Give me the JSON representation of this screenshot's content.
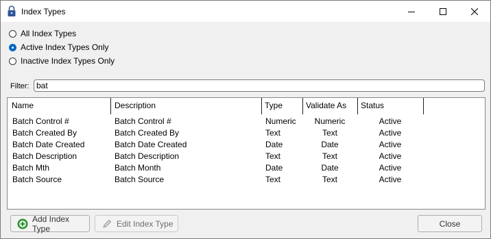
{
  "window": {
    "title": "Index Types",
    "icons": {
      "app": "padlock-icon",
      "minimize": "minimize-icon",
      "maximize": "maximize-icon",
      "close": "close-icon"
    }
  },
  "filter_options": [
    {
      "label": "All Index Types",
      "checked": false
    },
    {
      "label": "Active Index Types Only",
      "checked": true
    },
    {
      "label": "Inactive Index Types Only",
      "checked": false
    }
  ],
  "filter": {
    "label": "Filter:",
    "value": "bat"
  },
  "list": {
    "columns": [
      "Name",
      "Description",
      "Type",
      "Validate As",
      "Status"
    ],
    "rows": [
      [
        "Batch Control #",
        "Batch Control #",
        "Numeric",
        "Numeric",
        "Active"
      ],
      [
        "Batch Created By",
        "Batch Created By",
        "Text",
        "Text",
        "Active"
      ],
      [
        "Batch Date Created",
        "Batch Date Created",
        "Date",
        "Date",
        "Active"
      ],
      [
        "Batch Description",
        "Batch Description",
        "Text",
        "Text",
        "Active"
      ],
      [
        "Batch Mth",
        "Batch Month",
        "Date",
        "Date",
        "Active"
      ],
      [
        "Batch Source",
        "Batch Source",
        "Text",
        "Text",
        "Active"
      ]
    ]
  },
  "buttons": {
    "add": "Add Index Type",
    "edit": "Edit Index Type",
    "close": "Close",
    "add_icon": "plus-circle-icon",
    "edit_icon": "pencil-icon"
  },
  "colors": {
    "accent": "#0067c0",
    "add_icon": "#3aa340"
  }
}
